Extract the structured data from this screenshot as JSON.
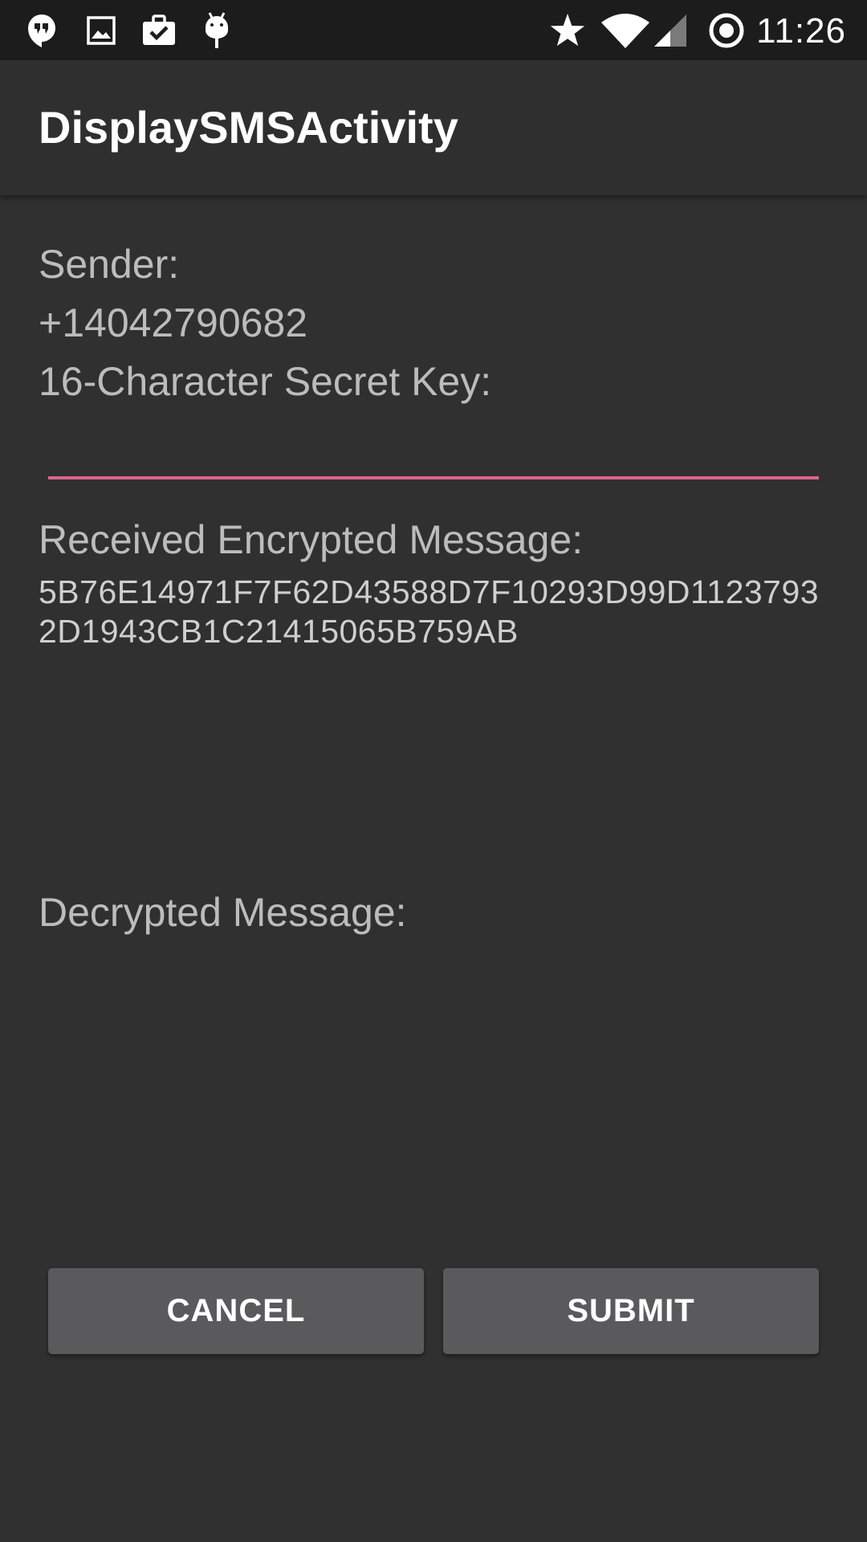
{
  "status_bar": {
    "time": "11:26",
    "icons_left": [
      "hangouts-icon",
      "image-icon",
      "briefcase-check-icon",
      "android-debug-icon"
    ],
    "icons_right": [
      "star-icon",
      "wifi-icon",
      "cell-signal-icon",
      "sync-icon"
    ]
  },
  "app_bar": {
    "title": "DisplaySMSActivity"
  },
  "form": {
    "sender_label": "Sender:",
    "sender_value": "+14042790682",
    "key_label": "16-Character Secret Key:",
    "key_value": "",
    "key_placeholder": "",
    "encrypted_label": "Received Encrypted Message:",
    "encrypted_value": "5B76E14971F7F62D43588D7F10293D99D11237932D1943CB1C21415065B759AB",
    "decrypted_label": "Decrypted Message:",
    "decrypted_value": ""
  },
  "buttons": {
    "cancel": "CANCEL",
    "submit": "SUBMIT"
  },
  "colors": {
    "accent": "#d9668a",
    "background": "#303030",
    "status_bar": "#1c1c1c",
    "button": "#5a5a5c"
  }
}
